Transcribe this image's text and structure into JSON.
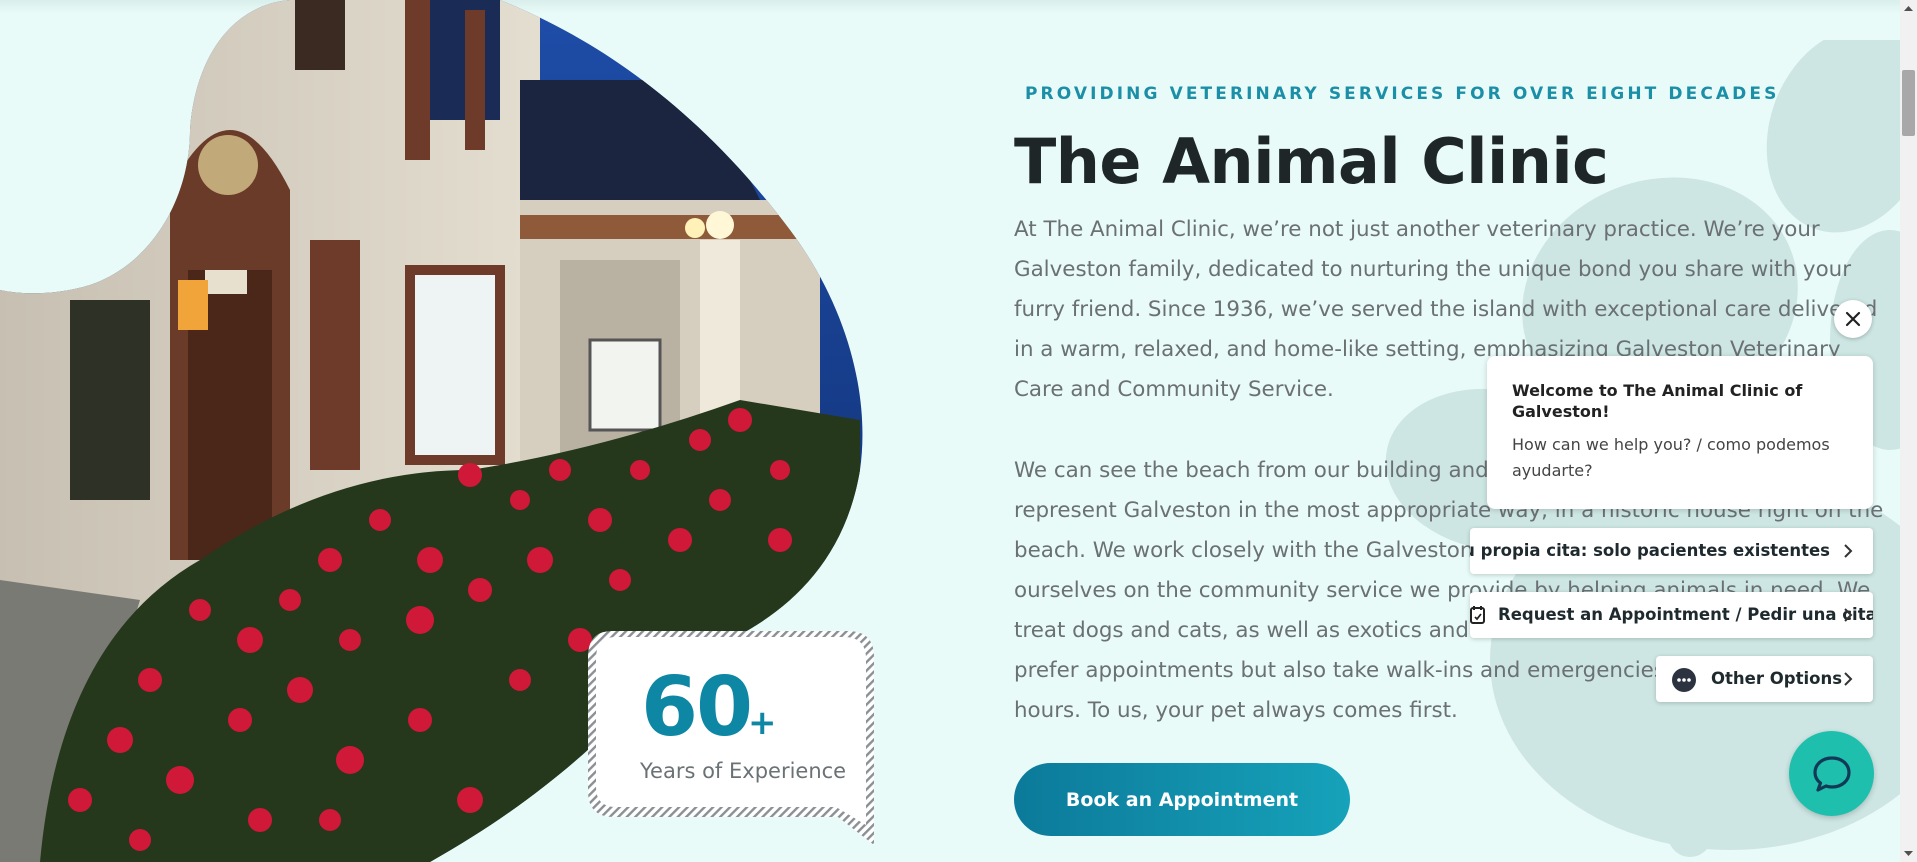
{
  "hero": {
    "eyebrow": "PROVIDING VETERINARY SERVICES FOR OVER EIGHT DECADES",
    "title": "The Animal Clinic",
    "paragraph1_lines": [
      "At The Animal Clinic, we’re not just another veterinary practice. We’re your",
      "Galveston family, dedicated to nurturing the unique bond you share with your",
      "furry friend. Since 1936, we’ve served the island with exceptional care delivered",
      "in a warm, relaxed, and home-like setting, emphasizing Galveston Veterinary",
      "Care and Community Service."
    ],
    "paragraph2_lines": [
      "We can see the beach from our building and b",
      "represent Galveston in the most appropriate way, in a historic house right on the",
      "beach. We work closely with the Galveston I",
      "ourselves on the community service we provide by helping animals in need. We",
      "treat dogs and cats, as well as exotics and s",
      "prefer appointments but also take walk-ins and emergencies",
      "hours. To us, your pet always comes first."
    ],
    "cta_label": "Book an Appointment"
  },
  "experience": {
    "number": "60",
    "plus": "+",
    "label": "Years of Experience"
  },
  "chat": {
    "close_icon": "close-icon",
    "welcome_title": "Welcome to The Animal Clinic of Galveston!",
    "welcome_subtitle": "How can we help you? / como podemos ayudarte?",
    "options": [
      {
        "label": "rve su propia cita: solo pacientes existentes",
        "icon": "none"
      },
      {
        "label": "Request an Appointment / Pedir una cita",
        "icon": "calendar-icon"
      },
      {
        "label": "Other Options",
        "icon": "more-dots-icon"
      }
    ],
    "launcher_icon": "chat-bubble-icon"
  },
  "colors": {
    "page_background": "#e9fbf8",
    "accent_teal": "#0d87a4",
    "chat_launcher": "#1fbfae",
    "heading": "#1e2628",
    "body_text": "#6a7073"
  },
  "scrollbar": {
    "position_fraction": 0.1
  }
}
